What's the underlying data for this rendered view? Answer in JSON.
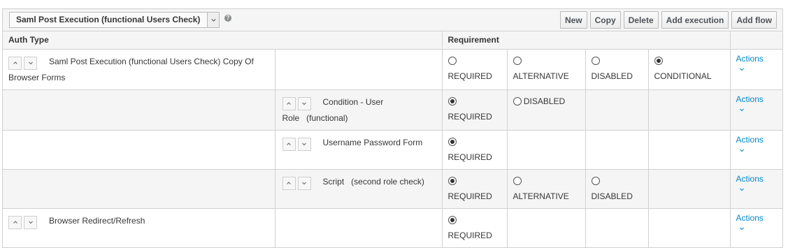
{
  "toolbar": {
    "flow_selected": "Saml Post Execution (functional Users Check)",
    "help": "?",
    "buttons": {
      "new": "New",
      "copy": "Copy",
      "delete": "Delete",
      "add_execution": "Add execution",
      "add_flow": "Add flow"
    }
  },
  "table": {
    "headers": {
      "auth_type": "Auth Type",
      "requirement": "Requirement"
    },
    "actions_label": "Actions",
    "rows": [
      {
        "name": "Saml Post Execution (functional Users Check) Copy Of Browser Forms",
        "level": 0,
        "options": [
          {
            "label": "REQUIRED",
            "selected": false
          },
          {
            "label": "ALTERNATIVE",
            "selected": false
          },
          {
            "label": "DISABLED",
            "selected": false
          },
          {
            "label": "CONDITIONAL",
            "selected": true
          }
        ]
      },
      {
        "name_line1": "Condition - User",
        "name_line2": "Role   (functional)",
        "level": 1,
        "options": [
          {
            "label": "REQUIRED",
            "selected": true
          },
          {
            "label": "DISABLED",
            "selected": false
          }
        ]
      },
      {
        "name": "Username Password Form",
        "level": 1,
        "options": [
          {
            "label": "REQUIRED",
            "selected": true
          }
        ]
      },
      {
        "name": "Script   (second role check)",
        "level": 1,
        "options": [
          {
            "label": "REQUIRED",
            "selected": true
          },
          {
            "label": "ALTERNATIVE",
            "selected": false
          },
          {
            "label": "DISABLED",
            "selected": false
          }
        ]
      },
      {
        "name": "Browser Redirect/Refresh",
        "level": 0,
        "options": [
          {
            "label": "REQUIRED",
            "selected": true
          }
        ]
      }
    ]
  },
  "colors": {
    "link": "#0088ce",
    "border": "#d1d1d1",
    "shade": "#f5f5f5"
  }
}
